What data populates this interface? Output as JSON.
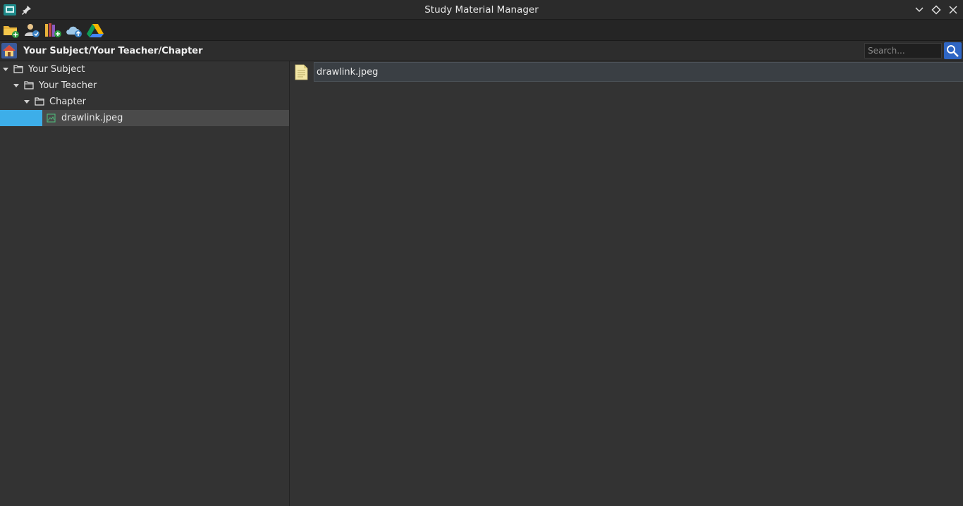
{
  "window": {
    "title": "Study Material Manager"
  },
  "toolbar": {
    "buttons": [
      {
        "name": "add-folder",
        "icon": "folder-add-icon"
      },
      {
        "name": "add-teacher",
        "icon": "user-add-icon"
      },
      {
        "name": "add-books",
        "icon": "books-add-icon"
      },
      {
        "name": "cloud-sync",
        "icon": "cloud-upload-icon"
      },
      {
        "name": "google-drive",
        "icon": "google-drive-icon"
      }
    ]
  },
  "pathbar": {
    "path": "Your Subject/Your Teacher/Chapter",
    "search_placeholder": "Search..."
  },
  "tree": {
    "items": [
      {
        "label": "Your Subject",
        "type": "folder",
        "level": 0,
        "expanded": true
      },
      {
        "label": "Your Teacher",
        "type": "folder",
        "level": 1,
        "expanded": true
      },
      {
        "label": "Chapter",
        "type": "folder",
        "level": 2,
        "expanded": true
      },
      {
        "label": "drawlink.jpeg",
        "type": "image",
        "level": 3,
        "selected": true
      }
    ]
  },
  "content": {
    "files": [
      {
        "name": "drawlink.jpeg"
      }
    ]
  },
  "colors": {
    "selection_accent": "#3daee9",
    "search_button": "#2f66c4",
    "background": "#333333"
  }
}
